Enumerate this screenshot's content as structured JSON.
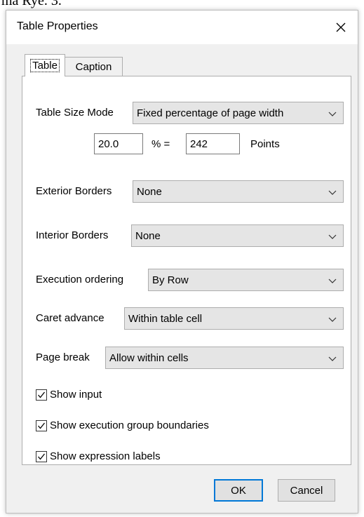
{
  "background_text": "ma Rye. 3.",
  "dialog": {
    "title": "Table Properties",
    "close_glyph": "✕"
  },
  "tabs": [
    {
      "label": "Table",
      "selected": true
    },
    {
      "label": "Caption",
      "selected": false
    }
  ],
  "table_size_mode": {
    "label": "Table Size Mode",
    "value": "Fixed percentage of page width"
  },
  "size": {
    "percent_value": "20.0",
    "percent_eq_label": "% =",
    "points_value": "242",
    "points_label": "Points"
  },
  "exterior_borders": {
    "label": "Exterior Borders",
    "value": "None"
  },
  "interior_borders": {
    "label": "Interior Borders",
    "value": "None"
  },
  "execution_ordering": {
    "label": "Execution ordering",
    "value": "By Row"
  },
  "caret_advance": {
    "label": "Caret advance",
    "value": "Within table cell"
  },
  "page_break": {
    "label": "Page break",
    "value": "Allow within cells"
  },
  "checkboxes": [
    {
      "label": "Show input",
      "checked": true
    },
    {
      "label": "Show execution group boundaries",
      "checked": true
    },
    {
      "label": "Show expression labels",
      "checked": true
    }
  ],
  "buttons": {
    "ok": "OK",
    "cancel": "Cancel"
  },
  "icons": {
    "close": "close-icon",
    "dropdown": "chevron-down-icon",
    "check": "checkmark-icon"
  },
  "colors": {
    "dialog_bg": "#f0f0f0",
    "panel_bg": "#ffffff",
    "combo_bg": "#e5e5e5",
    "button_bg": "#e1e1e1",
    "default_button_border": "#0078d7"
  }
}
